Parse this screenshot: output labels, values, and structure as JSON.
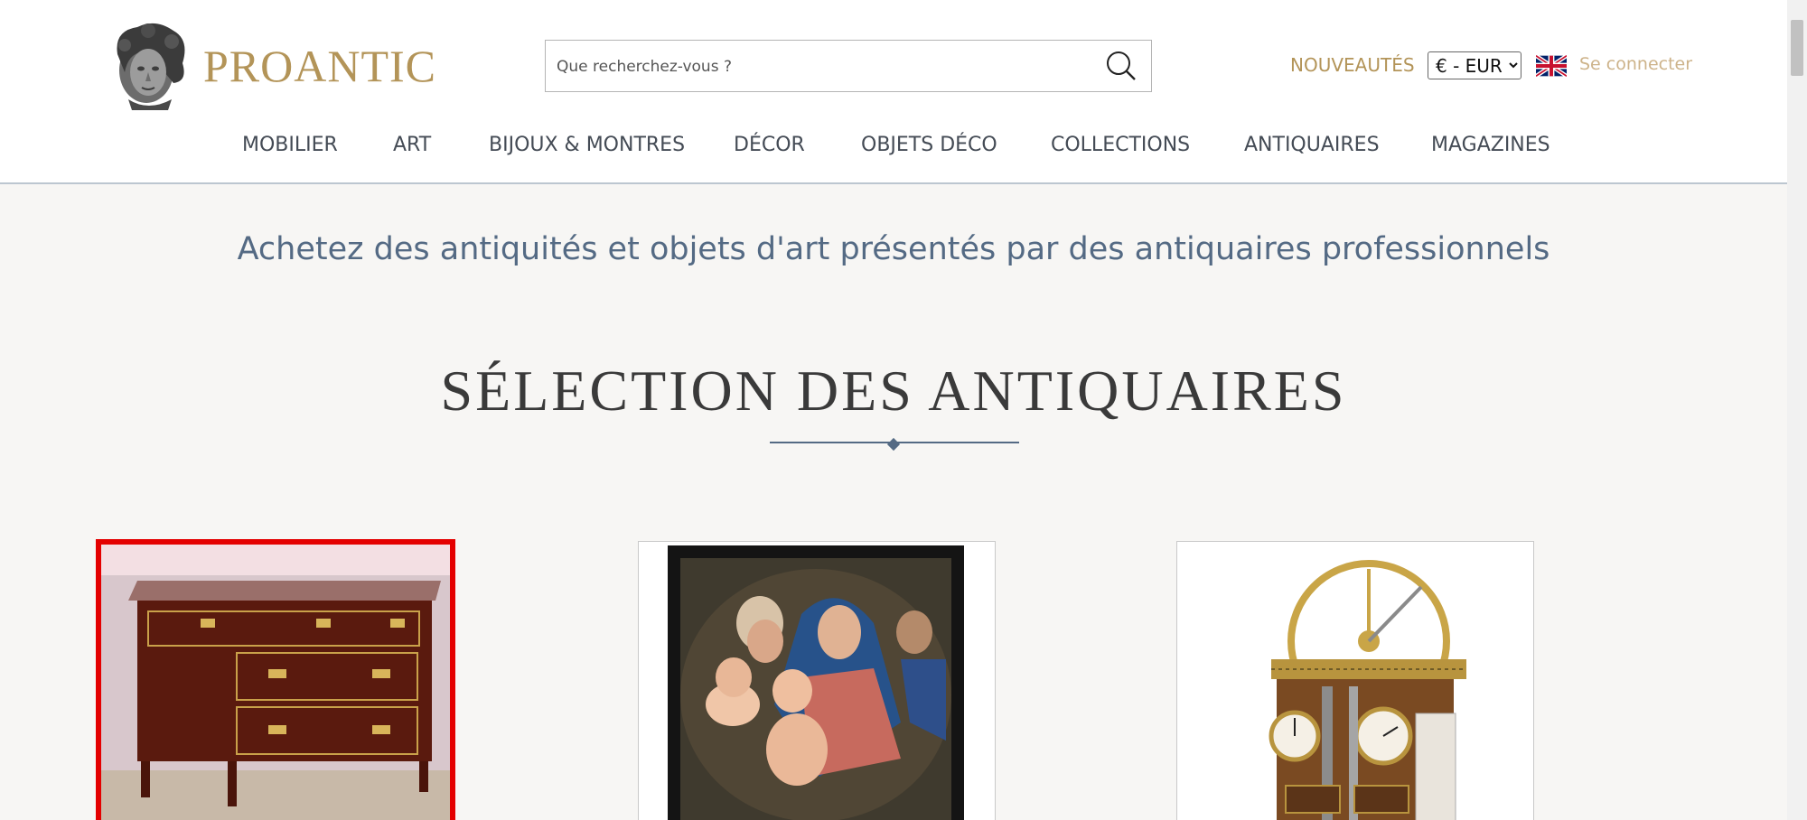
{
  "header": {
    "logo_text": "PROANTIC",
    "search_placeholder": "Que recherchez-vous ?",
    "nouveautes": "NOUVEAUTÉS",
    "currency": {
      "selected": "€ - EUR"
    },
    "login": "Se connecter",
    "language_flag": "uk-flag-icon"
  },
  "nav": {
    "items": [
      {
        "label": "MOBILIER"
      },
      {
        "label": "ART"
      },
      {
        "label": "BIJOUX & MONTRES"
      },
      {
        "label": "DÉCOR"
      },
      {
        "label": "OBJETS DÉCO"
      },
      {
        "label": "COLLECTIONS"
      },
      {
        "label": "ANTIQUAIRES"
      },
      {
        "label": "MAGAZINES"
      }
    ]
  },
  "main": {
    "tagline": "Achetez des antiquités et objets d'art présentés par des antiquaires professionnels",
    "section_title": "SÉLECTION DES ANTIQUAIRES"
  },
  "products": [
    {
      "image": "mahogany-commode-image",
      "selected": true
    },
    {
      "image": "holy-family-painting-image",
      "selected": false
    },
    {
      "image": "steam-engine-clock-image",
      "selected": false
    }
  ],
  "colors": {
    "brand_gold": "#b39458",
    "nav_text": "#444b55",
    "tagline_blue": "#546a84",
    "selection_red": "#e40000",
    "background": "#f7f6f4"
  }
}
